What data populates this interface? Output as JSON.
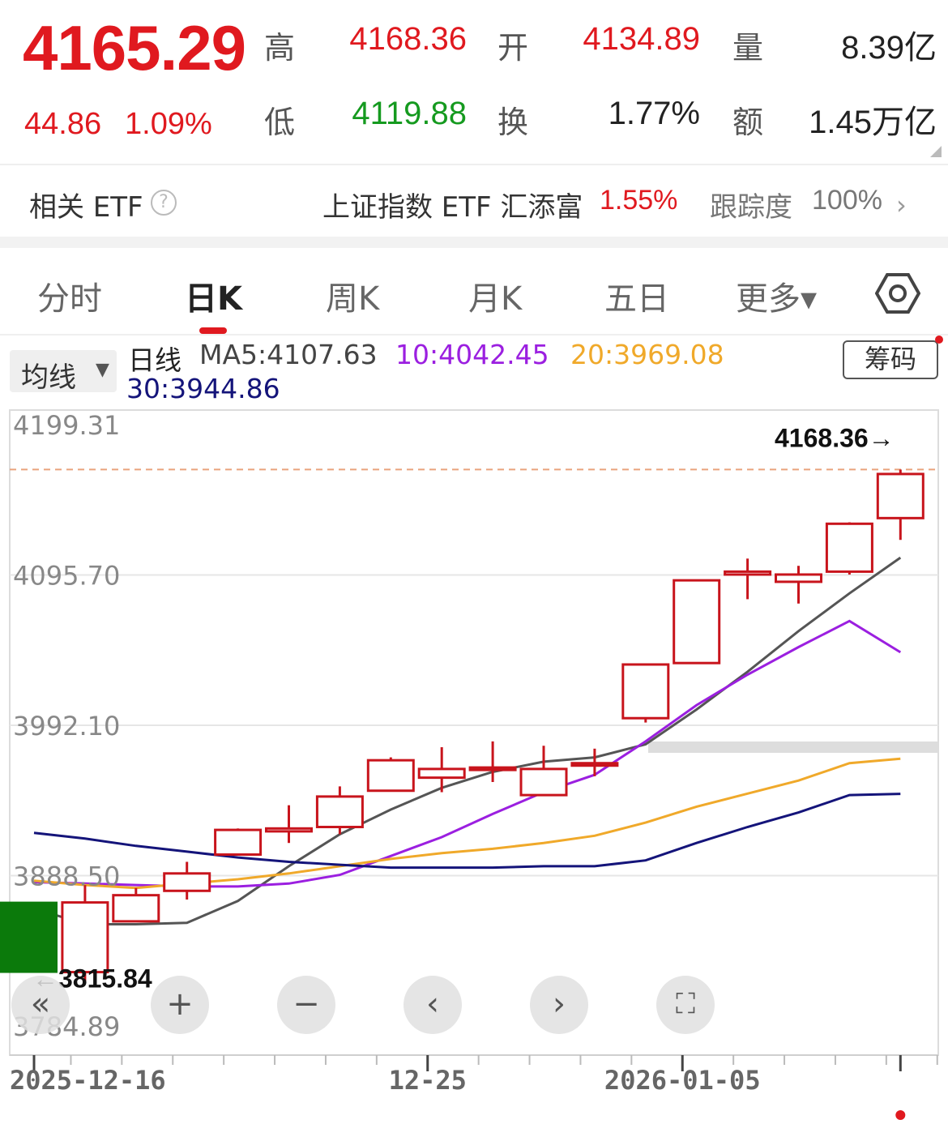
{
  "quote": {
    "price": "4165.29",
    "change": "44.86",
    "change_pct": "1.09%",
    "high_label": "高",
    "high": "4168.36",
    "low_label": "低",
    "low": "4119.88",
    "open_label": "开",
    "open": "4134.89",
    "turnover_label": "换",
    "turnover": "1.77%",
    "volume_label": "量",
    "volume": "8.39亿",
    "amount_label": "额",
    "amount": "1.45万亿"
  },
  "etf": {
    "title": "相关 ETF",
    "help": "?",
    "name": "上证指数 ETF 汇添富",
    "pct": "1.55%",
    "track_label": "跟踪度",
    "track_value": "100%",
    "chevron": "›"
  },
  "tabs": [
    "分时",
    "日K",
    "周K",
    "月K",
    "五日",
    "更多▾"
  ],
  "ma": {
    "select": "均线",
    "line_label": "日线",
    "ma5": "MA5:4107.63",
    "ma10": "10:4042.45",
    "ma20": "20:3969.08",
    "ma30": "30:3944.86",
    "chips": "筹码"
  },
  "colors": {
    "up": "#c8141c",
    "down": "#0b7a0b",
    "ma5": "#555555",
    "ma10": "#9b1fe0",
    "ma20": "#f0a92a",
    "ma30": "#14147a"
  },
  "controls": {
    "back": "«",
    "zoom_in": "+",
    "zoom_out": "−",
    "prev": "‹",
    "next": "›",
    "fullscreen": "⛶"
  },
  "chart_data": {
    "type": "candlestick",
    "y_ticks": [
      "4199.31",
      "4095.70",
      "3992.10",
      "3888.50",
      "3784.89"
    ],
    "y_tick_values": [
      4199.31,
      4095.7,
      3992.1,
      3888.5,
      3784.89
    ],
    "ylim": [
      3784.89,
      4199.31
    ],
    "x_ticks": [
      {
        "index": 0,
        "label": "2025-12-16"
      },
      {
        "index": 7,
        "label": "12-25"
      },
      {
        "index": 12,
        "label": "2026-01-05"
      }
    ],
    "high_marker": "4168.36→",
    "low_marker": "←3815.84",
    "candles": [
      {
        "o": 3870,
        "h": 3870,
        "l": 3822,
        "c": 3822
      },
      {
        "o": 3822,
        "h": 3882,
        "l": 3815.84,
        "c": 3870
      },
      {
        "o": 3857,
        "h": 3880,
        "l": 3857,
        "c": 3875
      },
      {
        "o": 3878,
        "h": 3898,
        "l": 3872,
        "c": 3890
      },
      {
        "o": 3903,
        "h": 3921,
        "l": 3903,
        "c": 3920
      },
      {
        "o": 3919,
        "h": 3937,
        "l": 3911,
        "c": 3921
      },
      {
        "o": 3922,
        "h": 3950,
        "l": 3917,
        "c": 3943
      },
      {
        "o": 3947,
        "h": 3970,
        "l": 3947,
        "c": 3968
      },
      {
        "o": 3956,
        "h": 3977,
        "l": 3946,
        "c": 3962
      },
      {
        "o": 3962,
        "h": 3981,
        "l": 3953,
        "c": 3963
      },
      {
        "o": 3944,
        "h": 3978,
        "l": 3944,
        "c": 3962
      },
      {
        "o": 3965,
        "h": 3976,
        "l": 3957,
        "c": 3966
      },
      {
        "o": 3997,
        "h": 4034,
        "l": 3994,
        "c": 4034
      },
      {
        "o": 4035,
        "h": 4092,
        "l": 4035,
        "c": 4092
      },
      {
        "o": 4096,
        "h": 4107,
        "l": 4079,
        "c": 4098
      },
      {
        "o": 4091,
        "h": 4102,
        "l": 4076,
        "c": 4096
      },
      {
        "o": 4098,
        "h": 4132,
        "l": 4096,
        "c": 4131
      },
      {
        "o": 4134.89,
        "h": 4168.36,
        "l": 4119.88,
        "c": 4165.29
      }
    ],
    "series": [
      {
        "name": "MA5",
        "values": [
          3866,
          3855,
          3855,
          3856,
          3871,
          3895,
          3917,
          3934,
          3949,
          3960,
          3967,
          3970,
          3979,
          4003,
          4029,
          4057,
          4083,
          4107.63
        ]
      },
      {
        "name": "10",
        "values": [
          3884,
          3883,
          3882,
          3881,
          3881,
          3883,
          3889,
          3902,
          3915,
          3931,
          3946,
          3958,
          3981,
          4006,
          4027,
          4046,
          4064,
          4042.45
        ]
      },
      {
        "name": "20",
        "values": [
          3885,
          3882,
          3880,
          3883,
          3886,
          3890,
          3895,
          3900,
          3904,
          3907,
          3911,
          3916,
          3925,
          3936,
          3945,
          3954,
          3966,
          3969.08
        ]
      },
      {
        "name": "30",
        "values": [
          3918,
          3914,
          3909,
          3905,
          3901,
          3898,
          3896,
          3894,
          3894,
          3894,
          3895,
          3895,
          3899,
          3911,
          3922,
          3932,
          3944,
          3944.86
        ]
      }
    ]
  }
}
